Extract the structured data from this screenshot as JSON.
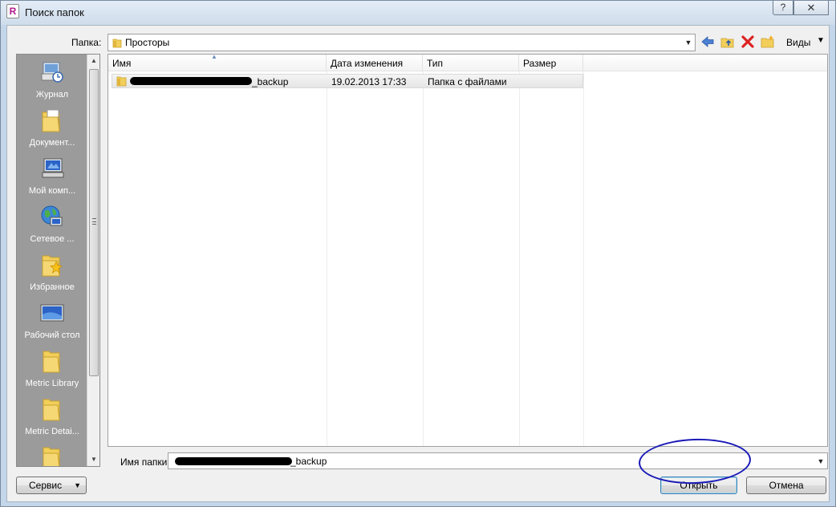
{
  "window": {
    "title": "Поиск папок",
    "help_label": "?",
    "close_label": "✕"
  },
  "toolbar": {
    "lookin_label": "Папка:",
    "lookin_value": "Просторы",
    "views_label": "Виды",
    "icons": [
      "back-arrow-icon",
      "up-folder-icon",
      "delete-icon",
      "new-folder-icon"
    ]
  },
  "places": [
    {
      "label": "Журнал",
      "icon": "history-icon"
    },
    {
      "label": "Документ...",
      "icon": "documents-folder-icon"
    },
    {
      "label": "Мой комп...",
      "icon": "my-computer-icon"
    },
    {
      "label": "Сетевое ...",
      "icon": "network-icon"
    },
    {
      "label": "Избранное",
      "icon": "favorites-icon"
    },
    {
      "label": "Рабочий стол",
      "icon": "desktop-icon"
    },
    {
      "label": "Metric Library",
      "icon": "folder-icon"
    },
    {
      "label": "Metric Detai...",
      "icon": "folder-icon"
    },
    {
      "label": "",
      "icon": "folder-icon"
    }
  ],
  "columns": {
    "name": "Имя",
    "date": "Дата изменения",
    "type": "Тип",
    "size": "Размер"
  },
  "rows": [
    {
      "name": "_backup",
      "date": "19.02.2013 17:33",
      "type": "Папка с файлами",
      "size": ""
    }
  ],
  "filename": {
    "label": "Имя папки:",
    "value": "_backup"
  },
  "buttons": {
    "service": "Сервис",
    "open": "Открыть",
    "cancel": "Отмена"
  },
  "colors": {
    "annotation_circle": "#1a1ab8",
    "places_bg": "#9b9b9b",
    "folder_yellow": "#f2cf5b"
  }
}
